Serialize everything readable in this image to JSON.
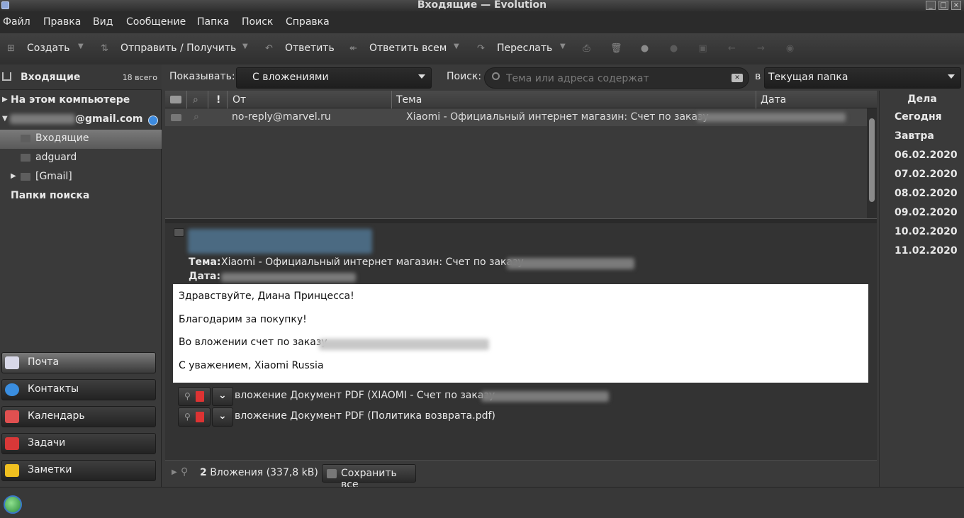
{
  "window": {
    "title": "Входящие — Evolution"
  },
  "menu": [
    "Файл",
    "Правка",
    "Вид",
    "Сообщение",
    "Папка",
    "Поиск",
    "Справка"
  ],
  "toolbar": {
    "new": "Создать",
    "send_receive": "Отправить / Получить",
    "reply": "Ответить",
    "reply_all": "Ответить всем",
    "forward": "Переслать"
  },
  "sidebar": {
    "current_folder": "Входящие",
    "total": "18 всего",
    "tree": {
      "local": "На этом компьютере",
      "account_suffix": "@gmail.com",
      "folders": [
        "Входящие",
        "adguard",
        "[Gmail]"
      ],
      "search_folders": "Папки поиска"
    },
    "nav": [
      "Почта",
      "Контакты",
      "Календарь",
      "Задачи",
      "Заметки"
    ]
  },
  "filter": {
    "show_label": "Показывать:",
    "show_value": "С вложениями",
    "search_label": "Поиск:",
    "search_placeholder": "Тема или адреса содержат",
    "in_label": "в",
    "scope_value": "Текущая папка"
  },
  "message_list": {
    "columns": [
      "От",
      "Тема",
      "Дата"
    ],
    "rows": [
      {
        "from": "no-reply@marvel.ru",
        "subject": "Xiaomi - Официальный интернет магазин: Счет по заказу"
      }
    ]
  },
  "preview": {
    "subject_label": "Тема:",
    "subject": "Xiaomi - Официальный интернет магазин: Счет по заказу",
    "date_label": "Дата:",
    "body": [
      "Здравствуйте, Диана Принцесса!",
      "Благодарим за покупку!",
      "Во вложении счет по заказу",
      "С уважением, Xiaomi Russia"
    ],
    "attachments": [
      "вложение Документ PDF (XIAOMI - Счет по заказу",
      "вложение Документ PDF (Политика возврата.pdf)"
    ]
  },
  "attachments_bar": {
    "count": "2",
    "summary": "Вложения (337,8 kB)",
    "save_all": "Сохранить все"
  },
  "tasks": {
    "header": "Дела",
    "items": [
      "Сегодня",
      "Завтра",
      "06.02.2020",
      "07.02.2020",
      "08.02.2020",
      "09.02.2020",
      "10.02.2020",
      "11.02.2020"
    ]
  }
}
